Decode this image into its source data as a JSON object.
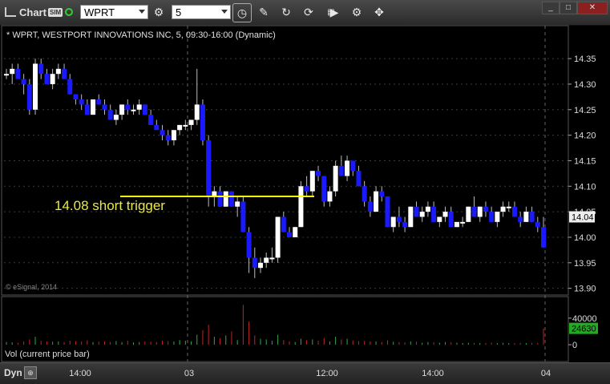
{
  "toolbar": {
    "app_title": "Chart",
    "sim_badge": "SIM",
    "symbol": "WPRT",
    "interval": "5",
    "icons": [
      "link-icon",
      "cycle-icon",
      "clock-icon",
      "pencil-icon",
      "draw-icon",
      "refresh-icon",
      "get-icon",
      "play-icon",
      "gear-icon",
      "tools-icon",
      "minimize-icon",
      "restore-icon",
      "close-icon"
    ],
    "win_min": "_",
    "win_max": "□",
    "win_close": "✕"
  },
  "chart": {
    "title": "* WPRT, WESTPORT INNOVATIONS INC, 5, 09:30-16:00 (Dynamic)",
    "annotation": "14.08 short trigger",
    "copyright": "© eSignal, 2014",
    "last_price_label": "14.04",
    "volume_label": "Vol (current price bar)",
    "volume_last_label": "24630",
    "colors": {
      "up": "#ffffff",
      "down": "#1a1aff",
      "trigger": "#ffff00",
      "vol_up": "#2ea84a",
      "vol_down": "#c42222",
      "vol_badge": "#22aa22"
    }
  },
  "footer": {
    "dyn": "Dyn",
    "lock": "⊕"
  },
  "chart_data": {
    "type": "candlestick",
    "price_axis": {
      "ticks": [
        "14.35",
        "14.30",
        "14.25",
        "14.20",
        "14.15",
        "14.10",
        "14.05",
        "14.00",
        "13.95",
        "13.90"
      ],
      "ylim": [
        13.89,
        14.38
      ]
    },
    "volume_axis": {
      "ticks": [
        "40000",
        "0"
      ],
      "ylim": [
        0,
        70000
      ]
    },
    "x_ticks": [
      "14:00",
      "03",
      "12:00",
      "14:00",
      "04"
    ],
    "trigger_level": 14.08,
    "bars": [
      [
        14.32,
        14.33,
        14.31,
        14.32,
        4000
      ],
      [
        14.32,
        14.34,
        14.3,
        14.33,
        3500
      ],
      [
        14.33,
        14.34,
        14.31,
        14.31,
        3000
      ],
      [
        14.31,
        14.32,
        14.28,
        14.3,
        5000
      ],
      [
        14.3,
        14.31,
        14.24,
        14.25,
        8000
      ],
      [
        14.25,
        14.35,
        14.24,
        14.34,
        12000
      ],
      [
        14.34,
        14.35,
        14.31,
        14.32,
        6000
      ],
      [
        14.32,
        14.33,
        14.3,
        14.3,
        5000
      ],
      [
        14.3,
        14.33,
        14.29,
        14.32,
        4500
      ],
      [
        14.32,
        14.34,
        14.31,
        14.33,
        5000
      ],
      [
        14.33,
        14.34,
        14.31,
        14.31,
        4000
      ],
      [
        14.31,
        14.32,
        14.28,
        14.28,
        6000
      ],
      [
        14.28,
        14.28,
        14.26,
        14.27,
        5500
      ],
      [
        14.27,
        14.28,
        14.25,
        14.26,
        5000
      ],
      [
        14.26,
        14.27,
        14.24,
        14.24,
        6500
      ],
      [
        14.24,
        14.27,
        14.24,
        14.27,
        4000
      ],
      [
        14.27,
        14.28,
        14.26,
        14.26,
        4500
      ],
      [
        14.26,
        14.27,
        14.24,
        14.25,
        5000
      ],
      [
        14.25,
        14.26,
        14.23,
        14.23,
        4000
      ],
      [
        14.23,
        14.25,
        14.22,
        14.24,
        5500
      ],
      [
        14.24,
        14.26,
        14.23,
        14.26,
        4000
      ],
      [
        14.26,
        14.27,
        14.24,
        14.25,
        6000
      ],
      [
        14.25,
        14.26,
        14.24,
        14.25,
        3500
      ],
      [
        14.25,
        14.27,
        14.24,
        14.26,
        4000
      ],
      [
        14.26,
        14.26,
        14.24,
        14.24,
        5000
      ],
      [
        14.24,
        14.25,
        14.22,
        14.22,
        4500
      ],
      [
        14.22,
        14.23,
        14.21,
        14.21,
        4000
      ],
      [
        14.21,
        14.22,
        14.19,
        14.2,
        6000
      ],
      [
        14.2,
        14.21,
        14.18,
        14.19,
        5500
      ],
      [
        14.19,
        14.21,
        14.18,
        14.21,
        5000
      ],
      [
        14.21,
        14.22,
        14.2,
        14.22,
        7000
      ],
      [
        14.22,
        14.23,
        14.21,
        14.22,
        6000
      ],
      [
        14.22,
        14.23,
        14.21,
        14.23,
        5000
      ],
      [
        14.23,
        14.33,
        14.22,
        14.26,
        15000
      ],
      [
        14.26,
        14.27,
        14.18,
        14.19,
        22000
      ],
      [
        14.19,
        14.2,
        14.06,
        14.08,
        30000
      ],
      [
        14.08,
        14.1,
        14.06,
        14.09,
        12000
      ],
      [
        14.09,
        14.1,
        14.06,
        14.06,
        10000
      ],
      [
        14.06,
        14.09,
        14.06,
        14.09,
        14000
      ],
      [
        14.09,
        14.09,
        14.06,
        14.06,
        20000
      ],
      [
        14.06,
        14.08,
        14.04,
        14.07,
        7000
      ],
      [
        14.07,
        14.08,
        14.01,
        14.01,
        60000
      ],
      [
        14.01,
        14.02,
        13.93,
        13.96,
        35000
      ],
      [
        13.96,
        13.98,
        13.92,
        13.94,
        14000
      ],
      [
        13.94,
        13.96,
        13.93,
        13.95,
        9000
      ],
      [
        13.95,
        13.97,
        13.94,
        13.96,
        8000
      ],
      [
        13.96,
        13.98,
        13.95,
        13.96,
        6000
      ],
      [
        13.96,
        14.04,
        13.95,
        14.04,
        15000
      ],
      [
        14.04,
        14.05,
        14.01,
        14.01,
        7000
      ],
      [
        14.01,
        14.02,
        14.0,
        14.0,
        5000
      ],
      [
        14.0,
        14.02,
        14.0,
        14.02,
        4000
      ],
      [
        14.02,
        14.11,
        14.02,
        14.1,
        9000
      ],
      [
        14.1,
        14.12,
        14.08,
        14.09,
        7000
      ],
      [
        14.09,
        14.13,
        14.08,
        14.13,
        8000
      ],
      [
        14.13,
        14.14,
        14.11,
        14.12,
        6000
      ],
      [
        14.12,
        14.12,
        14.06,
        14.07,
        10000
      ],
      [
        14.07,
        14.1,
        14.06,
        14.09,
        5000
      ],
      [
        14.09,
        14.15,
        14.08,
        14.14,
        12000
      ],
      [
        14.14,
        14.16,
        14.12,
        14.12,
        8000
      ],
      [
        14.12,
        14.16,
        14.11,
        14.15,
        9000
      ],
      [
        14.15,
        14.15,
        14.12,
        14.13,
        6500
      ],
      [
        14.13,
        14.14,
        14.1,
        14.1,
        5500
      ],
      [
        14.1,
        14.11,
        14.06,
        14.07,
        6000
      ],
      [
        14.07,
        14.08,
        14.04,
        14.05,
        5000
      ],
      [
        14.05,
        14.1,
        14.05,
        14.09,
        5000
      ],
      [
        14.09,
        14.1,
        14.07,
        14.08,
        4000
      ],
      [
        14.08,
        14.08,
        14.02,
        14.02,
        6500
      ],
      [
        14.02,
        14.04,
        14.01,
        14.04,
        4500
      ],
      [
        14.04,
        14.06,
        14.02,
        14.03,
        4000
      ],
      [
        14.03,
        14.04,
        14.01,
        14.02,
        3500
      ],
      [
        14.02,
        14.06,
        14.02,
        14.06,
        5000
      ],
      [
        14.06,
        14.07,
        14.04,
        14.04,
        4500
      ],
      [
        14.04,
        14.06,
        14.03,
        14.05,
        3000
      ],
      [
        14.05,
        14.07,
        14.04,
        14.06,
        4000
      ],
      [
        14.06,
        14.07,
        14.03,
        14.03,
        3500
      ],
      [
        14.03,
        14.04,
        14.02,
        14.04,
        3000
      ],
      [
        14.04,
        14.06,
        14.03,
        14.05,
        4000
      ],
      [
        14.05,
        14.06,
        14.02,
        14.02,
        3500
      ],
      [
        14.02,
        14.03,
        14.02,
        14.03,
        3000
      ],
      [
        14.03,
        14.04,
        14.02,
        14.03,
        2500
      ],
      [
        14.03,
        14.06,
        14.03,
        14.06,
        3000
      ],
      [
        14.06,
        14.08,
        14.04,
        14.04,
        2800
      ],
      [
        14.04,
        14.06,
        14.03,
        14.06,
        2500
      ],
      [
        14.06,
        14.07,
        14.04,
        14.05,
        2500
      ],
      [
        14.05,
        14.06,
        14.03,
        14.03,
        3000
      ],
      [
        14.03,
        14.05,
        14.02,
        14.05,
        2500
      ],
      [
        14.05,
        14.07,
        14.04,
        14.06,
        2800
      ],
      [
        14.06,
        14.07,
        14.05,
        14.06,
        2500
      ],
      [
        14.06,
        14.07,
        14.04,
        14.04,
        2500
      ],
      [
        14.04,
        14.05,
        14.02,
        14.03,
        2800
      ],
      [
        14.03,
        14.06,
        14.03,
        14.05,
        2500
      ],
      [
        14.05,
        14.06,
        14.03,
        14.03,
        3000
      ],
      [
        14.03,
        14.04,
        14.01,
        14.02,
        2800
      ],
      [
        14.02,
        14.04,
        13.98,
        13.98,
        24630
      ]
    ]
  }
}
